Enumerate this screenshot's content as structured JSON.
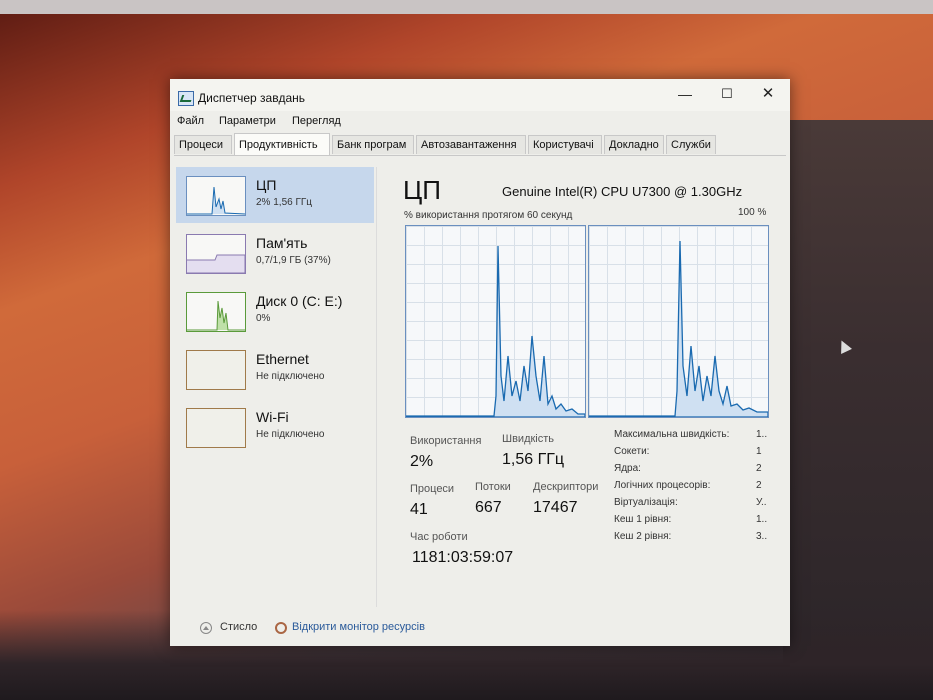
{
  "window": {
    "title": "Диспетчер завдань",
    "icon": "task-manager-icon",
    "buttons": {
      "minimize": "—",
      "maximize": "☐",
      "close": "✕"
    }
  },
  "menu": [
    "Файл",
    "Параметри",
    "Перегляд"
  ],
  "tabs": [
    {
      "label": "Процеси",
      "active": false
    },
    {
      "label": "Продуктивність",
      "active": true
    },
    {
      "label": "Банк програм",
      "active": false
    },
    {
      "label": "Автозавантаження",
      "active": false
    },
    {
      "label": "Користувачі",
      "active": false
    },
    {
      "label": "Докладно",
      "active": false
    },
    {
      "label": "Служби",
      "active": false
    }
  ],
  "sidebar": {
    "items": [
      {
        "title": "ЦП",
        "subtitle": "2% 1,56 ГГц",
        "active": true
      },
      {
        "title": "Пам'ять",
        "subtitle": "0,7/1,9 ГБ (37%)",
        "active": false
      },
      {
        "title": "Диск 0 (C: E:)",
        "subtitle": "0%",
        "active": false
      },
      {
        "title": "Ethernet",
        "subtitle": "Не підключено",
        "active": false
      },
      {
        "title": "Wi-Fi",
        "subtitle": "Не підключено",
        "active": false
      }
    ]
  },
  "main": {
    "title": "ЦП",
    "cpu_name": "Genuine Intel(R) CPU U7300 @ 1.30GHz",
    "graph_label": "% використання протягом 60 секунд",
    "graph_max": "100 %",
    "stats": {
      "usage_label": "Використання",
      "usage_value": "2%",
      "speed_label": "Швидкість",
      "speed_value": "1,56 ГГц",
      "processes_label": "Процеси",
      "processes_value": "41",
      "threads_label": "Потоки",
      "threads_value": "667",
      "handles_label": "Дескриптори",
      "handles_value": "17467",
      "uptime_label": "Час роботи",
      "uptime_value": "1181:03:59:07"
    },
    "info": [
      {
        "label": "Максимальна швидкість:",
        "value": "1.."
      },
      {
        "label": "Сокети:",
        "value": "1"
      },
      {
        "label": "Ядра:",
        "value": "2"
      },
      {
        "label": "Логічних процесорів:",
        "value": "2"
      },
      {
        "label": "Віртуалізація:",
        "value": "У.."
      },
      {
        "label": "Кеш 1 рівня:",
        "value": "1.."
      },
      {
        "label": "Кеш 2 рівня:",
        "value": "3.."
      }
    ]
  },
  "footer": {
    "less_details": "Стисло",
    "resource_monitor": "Відкрити монітор ресурсів"
  },
  "colors": {
    "graph_line": "#1a6ab0",
    "graph_fill": "#cfe0f2",
    "active_item": "#c6d7ec"
  }
}
